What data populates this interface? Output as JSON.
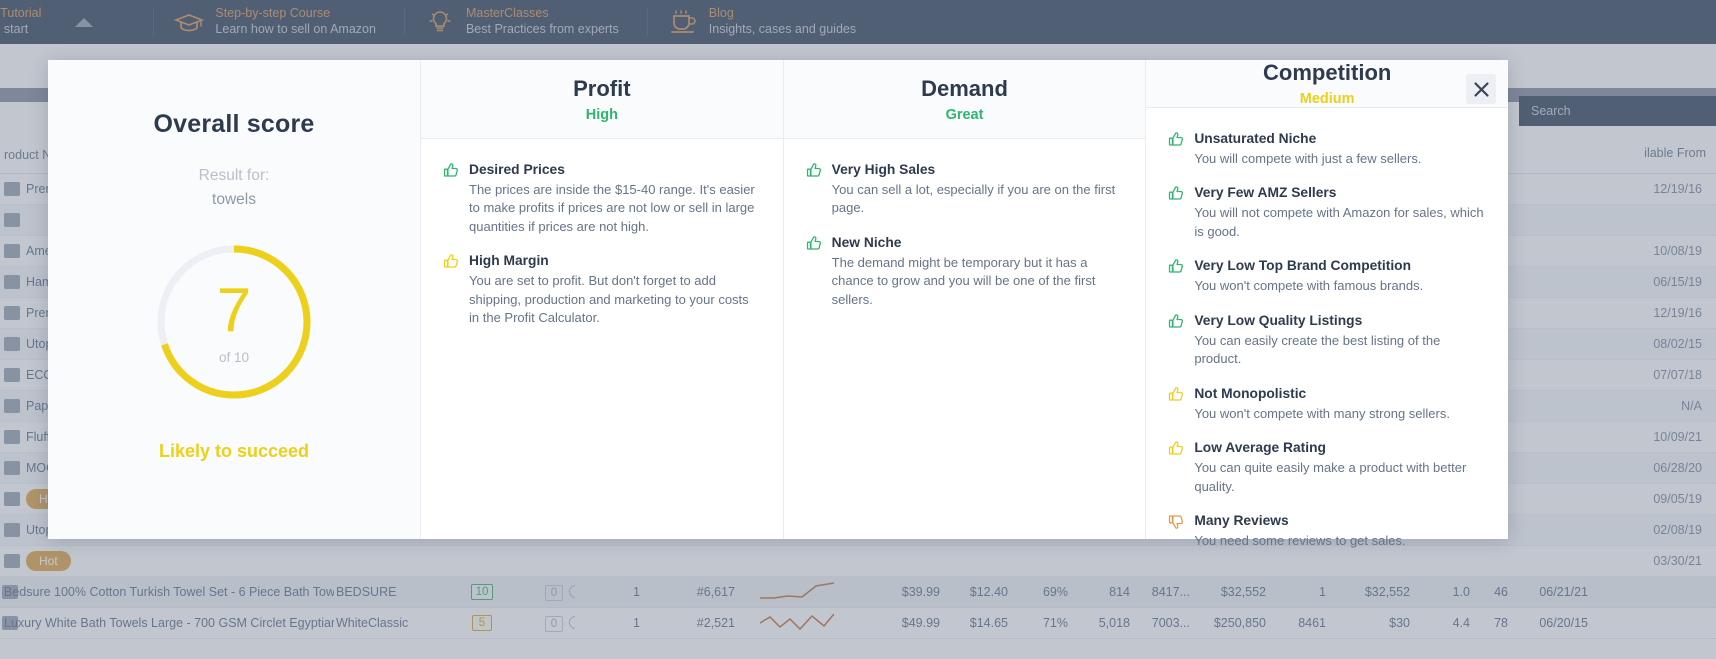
{
  "topnav": {
    "items": [
      {
        "icon": "play-circle-icon",
        "title": "o Tutorial",
        "sub": "to start"
      },
      {
        "icon": "graduation-cap-icon",
        "title": "Step-by-step Course",
        "sub": "Learn how to sell on Amazon"
      },
      {
        "icon": "lightbulb-icon",
        "title": "MasterClasses",
        "sub": "Best Practices from experts"
      },
      {
        "icon": "coffee-cup-icon",
        "title": "Blog",
        "sub": "Insights, cases and guides"
      }
    ],
    "collapse_icon": "caret-up-icon"
  },
  "background": {
    "search_label": "Search",
    "table": {
      "col_product": "roduct Na",
      "col_available_from": "ilable From",
      "rows": [
        {
          "name": "Premiu",
          "date": "12/19/16",
          "badge": ""
        },
        {
          "name": "",
          "date": "",
          "badge": ""
        },
        {
          "name": "America",
          "date": "10/08/19",
          "badge": ""
        },
        {
          "name": "Hamma",
          "date": "06/15/19",
          "badge": ""
        },
        {
          "name": "Premiu",
          "date": "12/19/16",
          "badge": ""
        },
        {
          "name": "Utopia ",
          "date": "08/02/15",
          "badge": ""
        },
        {
          "name": "ECO To",
          "date": "07/07/18",
          "badge": ""
        },
        {
          "name": "Papillon",
          "date": "N/A",
          "badge": ""
        },
        {
          "name": "Fluffyn",
          "date": "10/09/21",
          "badge": ""
        },
        {
          "name": "MOONG",
          "date": "06/28/20",
          "badge": ""
        },
        {
          "name": "",
          "date": "09/05/19",
          "badge": "Hot"
        },
        {
          "name": "Utopia ",
          "date": "02/08/19",
          "badge": ""
        },
        {
          "name": "",
          "date": "03/30/21",
          "badge": "Hot"
        }
      ],
      "detail_rows": [
        {
          "product": "Bedsure 100% Cotton Turkish Towel Set - 6 Piece Bath Towels ...",
          "brand": "BEDSURE",
          "score": "10",
          "score_tone": "green",
          "zero": "0",
          "count": "1",
          "rank": "#6,617",
          "price": "$39.99",
          "fees": "$12.40",
          "margin": "69%",
          "sales": "814",
          "bsr": "8417...",
          "revenue": "$32,552",
          "sellers": "1",
          "rev2": "$32,552",
          "rating": "1.0",
          "reviews": "46",
          "date": "06/21/21"
        },
        {
          "product": "Luxury White Bath Towels Large - 700 GSM Circlet Egyptian C...",
          "brand": "WhiteClassic",
          "score": "5",
          "score_tone": "amber",
          "zero": "0",
          "count": "1",
          "rank": "#2,521",
          "price": "$49.99",
          "fees": "$14.65",
          "margin": "71%",
          "sales": "5,018",
          "bsr": "7003...",
          "revenue": "$250,850",
          "sellers": "8461",
          "rev2": "$30",
          "rating": "4.4",
          "reviews": "78",
          "date": "06/20/15"
        }
      ]
    }
  },
  "modal": {
    "close_icon": "close-icon",
    "overall": {
      "title": "Overall score",
      "result_for_label": "Result for:",
      "keyword": "towels",
      "score": "7",
      "score_max_label": "of 10",
      "score_value": 7,
      "score_max": 10,
      "verdict": "Likely to succeed",
      "accent_color": "#ecd019",
      "track_color": "#eceff3"
    },
    "columns": [
      {
        "title": "Profit",
        "verdict": "High",
        "verdict_tone": "green",
        "items": [
          {
            "icon": "thumbs-up-icon",
            "tone": "green",
            "title": "Desired Prices",
            "desc": "The prices are inside the $15-40 range. It's easier to make profits if prices are not low or sell in large quantities if prices are not high."
          },
          {
            "icon": "thumbs-up-icon",
            "tone": "yellow",
            "title": "High Margin",
            "desc": "You are set to profit. But don't forget to add shipping, production and marketing to your costs in the Profit Calculator."
          }
        ]
      },
      {
        "title": "Demand",
        "verdict": "Great",
        "verdict_tone": "green",
        "items": [
          {
            "icon": "thumbs-up-icon",
            "tone": "green",
            "title": "Very High Sales",
            "desc": "You can sell a lot, especially if you are on the first page."
          },
          {
            "icon": "thumbs-up-icon",
            "tone": "green",
            "title": "New Niche",
            "desc": "The demand might be temporary but it has a chance to grow and you will be one of the first sellers."
          }
        ]
      },
      {
        "title": "Competition",
        "verdict": "Medium",
        "verdict_tone": "yellow",
        "items": [
          {
            "icon": "thumbs-up-icon",
            "tone": "green",
            "title": "Unsaturated Niche",
            "desc": "You will compete with just a few sellers."
          },
          {
            "icon": "thumbs-up-icon",
            "tone": "green",
            "title": "Very Few AMZ Sellers",
            "desc": "You will not compete with Amazon for sales, which is good."
          },
          {
            "icon": "thumbs-up-icon",
            "tone": "green",
            "title": "Very Low Top Brand Competition",
            "desc": "You won't compete with famous brands."
          },
          {
            "icon": "thumbs-up-icon",
            "tone": "green",
            "title": "Very Low Quality Listings",
            "desc": "You can easily create the best listing of the product."
          },
          {
            "icon": "thumbs-up-icon",
            "tone": "yellow",
            "title": "Not Monopolistic",
            "desc": "You won't compete with many strong sellers."
          },
          {
            "icon": "thumbs-up-icon",
            "tone": "yellow",
            "title": "Low Average Rating",
            "desc": "You can quite easily make a product with better quality."
          },
          {
            "icon": "thumbs-down-icon",
            "tone": "orange",
            "title": "Many Reviews",
            "desc": "You need some reviews to get sales."
          }
        ]
      }
    ]
  }
}
